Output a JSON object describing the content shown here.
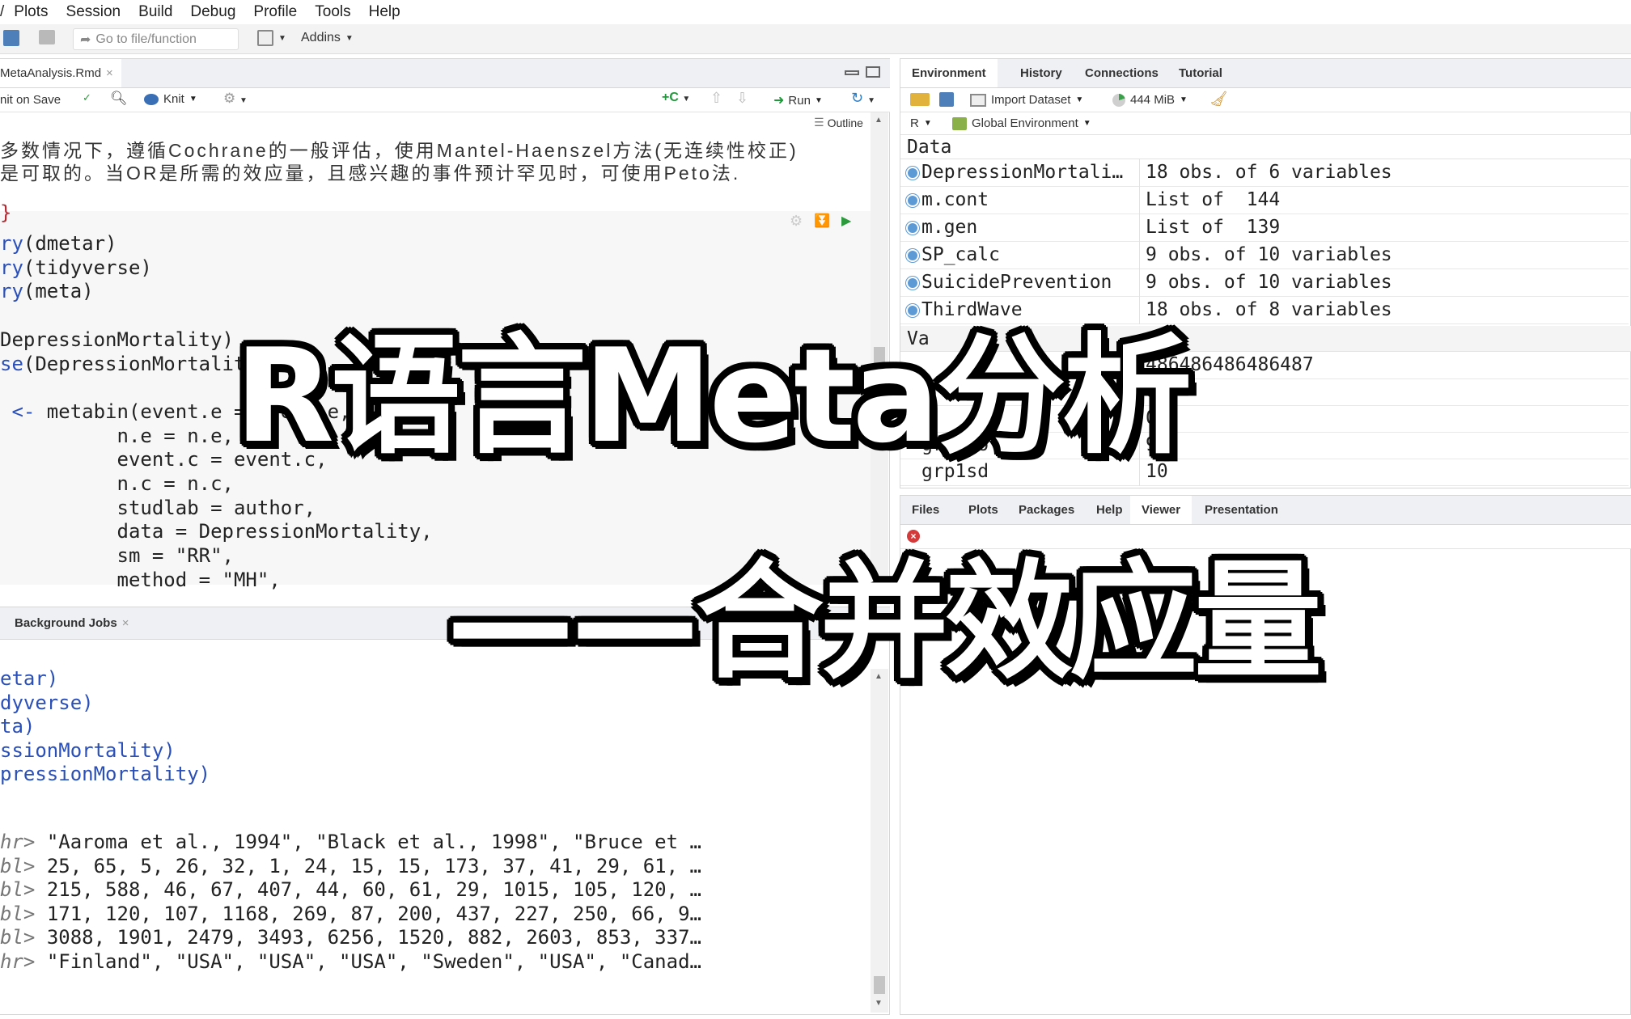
{
  "menu": [
    "Plots",
    "Session",
    "Build",
    "Debug",
    "Profile",
    "Tools",
    "Help"
  ],
  "toolbar": {
    "goto_placeholder": "Go to file/function",
    "addins": "Addins"
  },
  "editor": {
    "tab_label": "MetaAnalysis.Rmd",
    "toolbar": {
      "knit_on_save": "nit on Save",
      "knit": "Knit",
      "run": "Run",
      "outline": "Outline"
    },
    "prose": [
      "多数情况下，遵循Cochrane的一般评估，使用Mantel-Haenszel方法(无连续性校正)",
      "是可取的。当OR是所需的效应量，且感兴趣的事件预计罕见时，可使用Peto法."
    ],
    "chunk_close": "}",
    "code": [
      {
        "a": "ry",
        "b": "(dmetar)"
      },
      {
        "a": "ry",
        "b": "(tidyverse)"
      },
      {
        "a": "ry",
        "b": "(meta)"
      },
      {
        "a": "",
        "b": ""
      },
      {
        "a": "",
        "b": "DepressionMortality)"
      },
      {
        "a": "se",
        "b": "(DepressionMortality)"
      },
      {
        "a": "",
        "b": ""
      },
      {
        "a": " <- ",
        "b": "metabin(event.e = event.e,"
      },
      {
        "a": "",
        "b": "          n.e = n.e,"
      },
      {
        "a": "",
        "b": "          event.c = event.c,"
      },
      {
        "a": "",
        "b": "          n.c = n.c,"
      },
      {
        "a": "",
        "b": "          studlab = author,"
      },
      {
        "a": "",
        "b": "          data = DepressionMortality,"
      },
      {
        "a": "",
        "b": "          sm = \"RR\","
      },
      {
        "a": "",
        "b": "          method = \"MH\","
      }
    ]
  },
  "console": {
    "tab_label": "Background Jobs",
    "echo": [
      "etar)",
      "dyverse)",
      "ta)",
      "ssionMortality)",
      "pressionMortality)"
    ],
    "glimpse": [
      {
        "t": "hr>",
        "v": "\"Aaroma et al., 1994\", \"Black et al., 1998\", \"Bruce et …"
      },
      {
        "t": "bl>",
        "v": "25, 65, 5, 26, 32, 1, 24, 15, 15, 173, 37, 41, 29, 61, …"
      },
      {
        "t": "bl>",
        "v": "215, 588, 46, 67, 407, 44, 60, 61, 29, 1015, 105, 120, …"
      },
      {
        "t": "bl>",
        "v": "171, 120, 107, 1168, 269, 87, 200, 437, 227, 250, 66, 9…"
      },
      {
        "t": "bl>",
        "v": "3088, 1901, 2479, 3493, 6256, 1520, 882, 2603, 853, 337…"
      },
      {
        "t": "hr>",
        "v": "\"Finland\", \"USA\", \"USA\", \"USA\", \"Sweden\", \"USA\", \"Canad…"
      }
    ]
  },
  "env": {
    "tabs": [
      "Environment",
      "History",
      "Connections",
      "Tutorial"
    ],
    "import_dataset": "Import Dataset",
    "memory": "444 MiB",
    "lang": "R",
    "scope": "Global Environment",
    "data_header": "Data",
    "values_header": "Va",
    "rows": [
      {
        "name": "DepressionMortali…",
        "value": "18 obs. of 6 variables"
      },
      {
        "name": "m.cont",
        "value": "List of  144"
      },
      {
        "name": "m.gen",
        "value": "List of  139"
      },
      {
        "name": "SP_calc",
        "value": "9 obs. of 10 variables"
      },
      {
        "name": "SuicidePrevention",
        "value": "9 obs. of 10 variables"
      },
      {
        "name": "ThirdWave",
        "value": "18 obs. of 8 variables"
      }
    ],
    "values": [
      {
        "name": "",
        "value": "486486486486487"
      },
      {
        "name": "g",
        "value": "0"
      },
      {
        "name": "",
        "value": "00"
      },
      {
        "name": "grp1no",
        "value": "98"
      },
      {
        "name": "grp1sd",
        "value": "10"
      }
    ]
  },
  "files": {
    "tabs": [
      "Files",
      "Plots",
      "Packages",
      "Help",
      "Viewer",
      "Presentation"
    ]
  },
  "overlay": {
    "line1": "R语言Meta分析",
    "line2": "——合并效应量"
  }
}
